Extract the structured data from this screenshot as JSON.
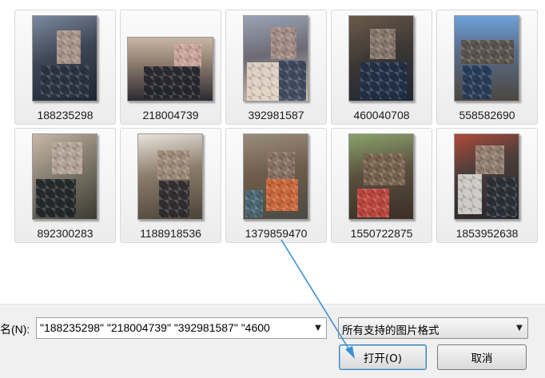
{
  "thumbnails": [
    {
      "caption": "188235298"
    },
    {
      "caption": "218004739"
    },
    {
      "caption": "392981587"
    },
    {
      "caption": "460040708"
    },
    {
      "caption": "558582690"
    },
    {
      "caption": "892300283"
    },
    {
      "caption": "1188918536"
    },
    {
      "caption": "1379859470"
    },
    {
      "caption": "1550722875"
    },
    {
      "caption": "1853952638"
    }
  ],
  "filename": {
    "label": "名(N):",
    "value": "\"188235298\" \"218004739\" \"392981587\" \"4600"
  },
  "filetype": {
    "selected": "所有支持的图片格式"
  },
  "buttons": {
    "open": "打开(O)",
    "cancel": "取消"
  },
  "colors": {
    "annotation_arrow": "#3b8fd6"
  }
}
